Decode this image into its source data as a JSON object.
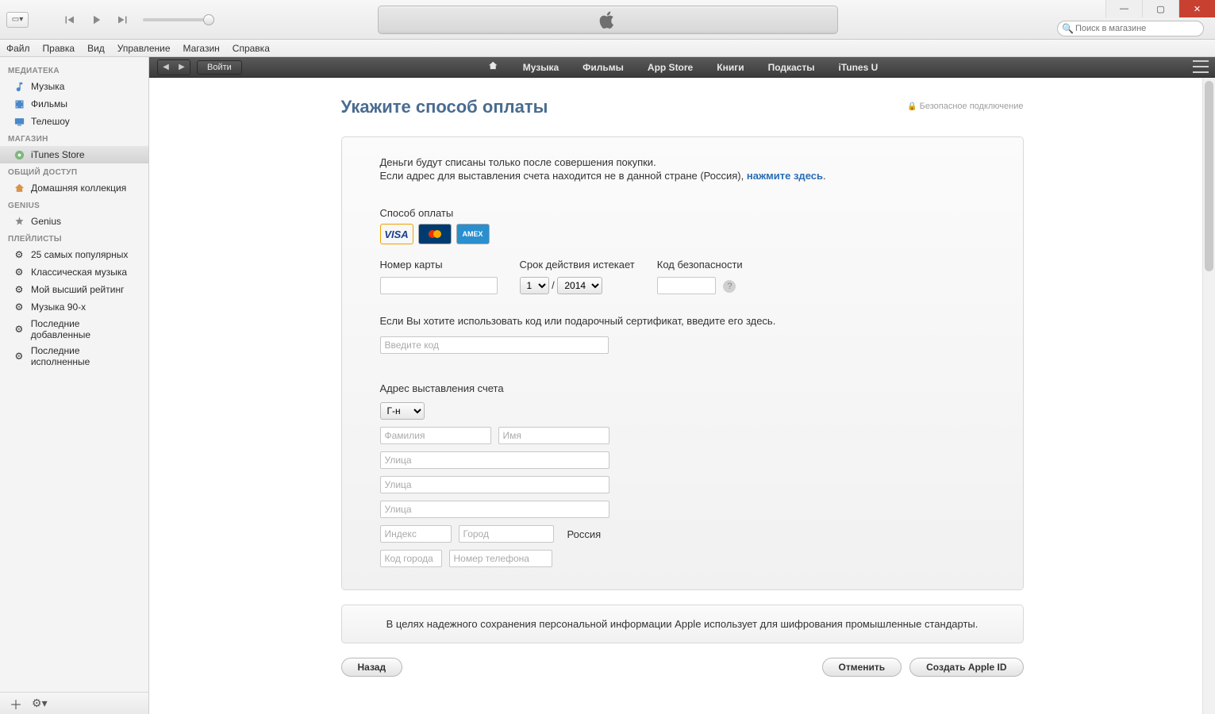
{
  "window": {
    "search_placeholder": "Поиск в магазине"
  },
  "menu": [
    "Файл",
    "Правка",
    "Вид",
    "Управление",
    "Магазин",
    "Справка"
  ],
  "sidebar": {
    "sections": {
      "library": "МЕДИАТЕКА",
      "store": "МАГАЗИН",
      "shared": "ОБЩИЙ ДОСТУП",
      "genius": "GENIUS",
      "playlists": "ПЛЕЙЛИСТЫ"
    },
    "library": [
      {
        "label": "Музыка"
      },
      {
        "label": "Фильмы"
      },
      {
        "label": "Телешоу"
      }
    ],
    "store_item": "iTunes Store",
    "shared_item": "Домашняя коллекция",
    "genius_item": "Genius",
    "playlists": [
      "25 самых популярных",
      "Классическая музыка",
      "Мой высший рейтинг",
      "Музыка 90-х",
      "Последние добавленные",
      "Последние исполненные"
    ]
  },
  "store_nav": {
    "signin": "Войти",
    "links": [
      "Музыка",
      "Фильмы",
      "App Store",
      "Книги",
      "Подкасты",
      "iTunes U"
    ]
  },
  "page": {
    "title": "Укажите способ оплаты",
    "secure": "Безопасное подключение",
    "info1": "Деньги будут списаны только после совершения покупки.",
    "info2a": "Если адрес для выставления счета находится не в данной стране (Россия), ",
    "info2b": "нажмите здесь",
    "info2c": ".",
    "pay_method_label": "Способ оплаты",
    "card_number_label": "Номер карты",
    "expiry_label": "Срок действия истекает",
    "expiry_month": "1",
    "expiry_year": "2014",
    "cvv_label": "Код безопасности",
    "gift_text": "Если Вы хотите использовать код или подарочный сертификат, введите его здесь.",
    "code_placeholder": "Введите код",
    "billing_label": "Адрес выставления счета",
    "salutation": "Г-н",
    "ph_lastname": "Фамилия",
    "ph_firstname": "Имя",
    "ph_street": "Улица",
    "ph_index": "Индекс",
    "ph_city": "Город",
    "country": "Россия",
    "ph_areacode": "Код города",
    "ph_phone": "Номер телефона",
    "footnote": "В целях надежного сохранения персональной информации Apple использует для шифрования промышленные стандарты.",
    "back": "Назад",
    "cancel": "Отменить",
    "create": "Создать Apple ID"
  }
}
